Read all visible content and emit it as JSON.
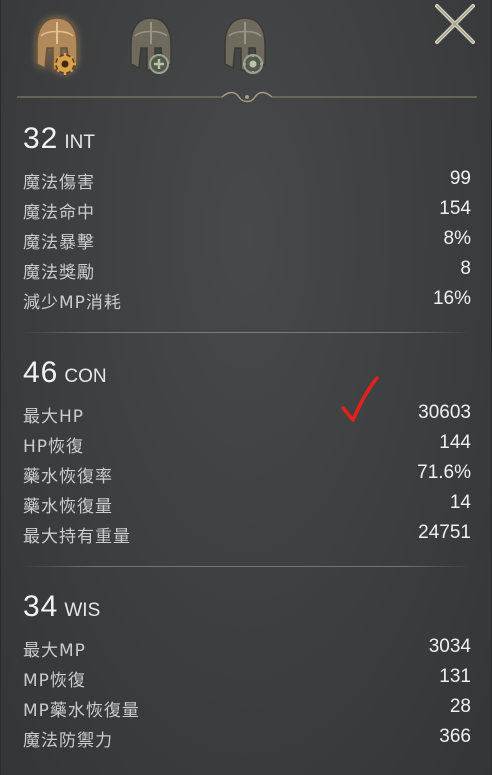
{
  "tabs": [
    {
      "icon": "helmet-gear-icon",
      "active": true
    },
    {
      "icon": "helmet-plus-icon",
      "active": false
    },
    {
      "icon": "helmet-gear-icon",
      "active": false
    }
  ],
  "colors": {
    "accent_gold": "#c9a777",
    "check_red": "#e8201c"
  },
  "sections": [
    {
      "value": "32",
      "abbr": "INT",
      "rows": [
        {
          "label": "魔法傷害",
          "value": "99"
        },
        {
          "label": "魔法命中",
          "value": "154"
        },
        {
          "label": "魔法暴擊",
          "value": "8%"
        },
        {
          "label": "魔法獎勵",
          "value": "8"
        },
        {
          "label": "減少MP消耗",
          "value": "16%"
        }
      ]
    },
    {
      "value": "46",
      "abbr": "CON",
      "rows": [
        {
          "label": "最大HP",
          "value": "30603"
        },
        {
          "label": "HP恢復",
          "value": "144"
        },
        {
          "label": "藥水恢復率",
          "value": "71.6%"
        },
        {
          "label": "藥水恢復量",
          "value": "14"
        },
        {
          "label": "最大持有重量",
          "value": "24751"
        }
      ]
    },
    {
      "value": "34",
      "abbr": "WIS",
      "rows": [
        {
          "label": "最大MP",
          "value": "3034"
        },
        {
          "label": "MP恢復",
          "value": "131"
        },
        {
          "label": "MP藥水恢復量",
          "value": "28"
        },
        {
          "label": "魔法防禦力",
          "value": "366"
        }
      ]
    }
  ]
}
